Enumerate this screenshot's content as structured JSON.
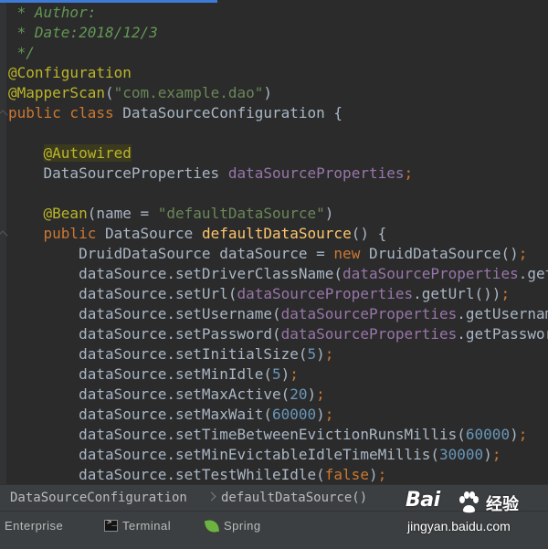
{
  "editor": {
    "lines": [
      {
        "segments": [
          {
            "c": "comment",
            "t": " * Author:"
          }
        ]
      },
      {
        "segments": [
          {
            "c": "comment",
            "t": " * Date:2018/12/3"
          }
        ]
      },
      {
        "segments": [
          {
            "c": "comment",
            "t": " */"
          }
        ]
      },
      {
        "segments": [
          {
            "c": "anno",
            "t": "@Configuration"
          }
        ]
      },
      {
        "segments": [
          {
            "c": "anno",
            "t": "@MapperScan"
          },
          {
            "c": "plain",
            "t": "("
          },
          {
            "c": "str",
            "t": "\"com.example.dao\""
          },
          {
            "c": "plain",
            "t": ")"
          }
        ]
      },
      {
        "segments": [
          {
            "c": "kw",
            "t": "public class "
          },
          {
            "c": "plain",
            "t": "DataSourceConfiguration {"
          }
        ]
      },
      {
        "segments": [
          {
            "c": "plain",
            "t": ""
          }
        ]
      },
      {
        "segments": [
          {
            "c": "plain",
            "t": "    "
          },
          {
            "c": "anno-hl",
            "t": "@Autowired"
          }
        ]
      },
      {
        "segments": [
          {
            "c": "plain",
            "t": "    DataSourceProperties "
          },
          {
            "c": "field",
            "t": "dataSourceProperties"
          },
          {
            "c": "kw",
            "t": ";"
          }
        ]
      },
      {
        "segments": [
          {
            "c": "plain",
            "t": ""
          }
        ]
      },
      {
        "segments": [
          {
            "c": "plain",
            "t": "    "
          },
          {
            "c": "anno",
            "t": "@Bean"
          },
          {
            "c": "plain",
            "t": "(name = "
          },
          {
            "c": "str",
            "t": "\"defaultDataSource\""
          },
          {
            "c": "plain",
            "t": ")"
          }
        ]
      },
      {
        "segments": [
          {
            "c": "plain",
            "t": "    "
          },
          {
            "c": "kw",
            "t": "public "
          },
          {
            "c": "plain",
            "t": "DataSource "
          },
          {
            "c": "meth",
            "t": "defaultDataSource"
          },
          {
            "c": "plain",
            "t": "() {"
          }
        ]
      },
      {
        "segments": [
          {
            "c": "plain",
            "t": "        DruidDataSource dataSource = "
          },
          {
            "c": "kw",
            "t": "new "
          },
          {
            "c": "plain",
            "t": "DruidDataSource()"
          },
          {
            "c": "kw",
            "t": ";"
          }
        ]
      },
      {
        "segments": [
          {
            "c": "plain",
            "t": "        dataSource.setDriverClassName("
          },
          {
            "c": "field",
            "t": "dataSourceProperties"
          },
          {
            "c": "plain",
            "t": ".getDriverClassName())"
          }
        ]
      },
      {
        "segments": [
          {
            "c": "plain",
            "t": "        dataSource.setUrl("
          },
          {
            "c": "field",
            "t": "dataSourceProperties"
          },
          {
            "c": "plain",
            "t": ".getUrl())"
          },
          {
            "c": "kw",
            "t": ";"
          }
        ]
      },
      {
        "segments": [
          {
            "c": "plain",
            "t": "        dataSource.setUsername("
          },
          {
            "c": "field",
            "t": "dataSourceProperties"
          },
          {
            "c": "plain",
            "t": ".getUsername())"
          }
        ]
      },
      {
        "segments": [
          {
            "c": "plain",
            "t": "        dataSource.setPassword("
          },
          {
            "c": "field",
            "t": "dataSourceProperties"
          },
          {
            "c": "plain",
            "t": ".getPassword())"
          }
        ]
      },
      {
        "segments": [
          {
            "c": "plain",
            "t": "        dataSource.setInitialSize("
          },
          {
            "c": "num",
            "t": "5"
          },
          {
            "c": "plain",
            "t": ")"
          },
          {
            "c": "kw",
            "t": ";"
          }
        ]
      },
      {
        "segments": [
          {
            "c": "plain",
            "t": "        dataSource.setMinIdle("
          },
          {
            "c": "num",
            "t": "5"
          },
          {
            "c": "plain",
            "t": ")"
          },
          {
            "c": "kw",
            "t": ";"
          }
        ]
      },
      {
        "segments": [
          {
            "c": "plain",
            "t": "        dataSource.setMaxActive("
          },
          {
            "c": "num",
            "t": "20"
          },
          {
            "c": "plain",
            "t": ")"
          },
          {
            "c": "kw",
            "t": ";"
          }
        ]
      },
      {
        "segments": [
          {
            "c": "plain",
            "t": "        dataSource.setMaxWait("
          },
          {
            "c": "num",
            "t": "60000"
          },
          {
            "c": "plain",
            "t": ")"
          },
          {
            "c": "kw",
            "t": ";"
          }
        ]
      },
      {
        "segments": [
          {
            "c": "plain",
            "t": "        dataSource.setTimeBetweenEvictionRunsMillis("
          },
          {
            "c": "num",
            "t": "60000"
          },
          {
            "c": "plain",
            "t": ")"
          },
          {
            "c": "kw",
            "t": ";"
          }
        ]
      },
      {
        "segments": [
          {
            "c": "plain",
            "t": "        dataSource.setMinEvictableIdleTimeMillis("
          },
          {
            "c": "num",
            "t": "30000"
          },
          {
            "c": "plain",
            "t": ")"
          },
          {
            "c": "kw",
            "t": ";"
          }
        ]
      },
      {
        "segments": [
          {
            "c": "plain",
            "t": "        dataSource.setTestWhileIdle("
          },
          {
            "c": "kw",
            "t": "false"
          },
          {
            "c": "plain",
            "t": ")"
          },
          {
            "c": "kw",
            "t": ";"
          }
        ]
      }
    ]
  },
  "breadcrumb": {
    "class_name": "DataSourceConfiguration",
    "method_name": "defaultDataSource()"
  },
  "toolbar": {
    "enterprise_label": "Enterprise",
    "terminal_label": "Terminal",
    "terminal_icon_glyph": ">_",
    "spring_label": "Spring"
  },
  "watermark": {
    "logo_text": "Bai",
    "brand_text": "经验",
    "url_text": "jingyan.baidu.com"
  },
  "colors": {
    "background": "#2b2b2b",
    "keyword": "#cc7832",
    "annotation": "#bbb529",
    "string": "#6a8759",
    "field": "#9876aa",
    "number": "#6897bb",
    "method": "#ffc66d",
    "comment": "#629755",
    "accent": "#3d7bd6"
  }
}
